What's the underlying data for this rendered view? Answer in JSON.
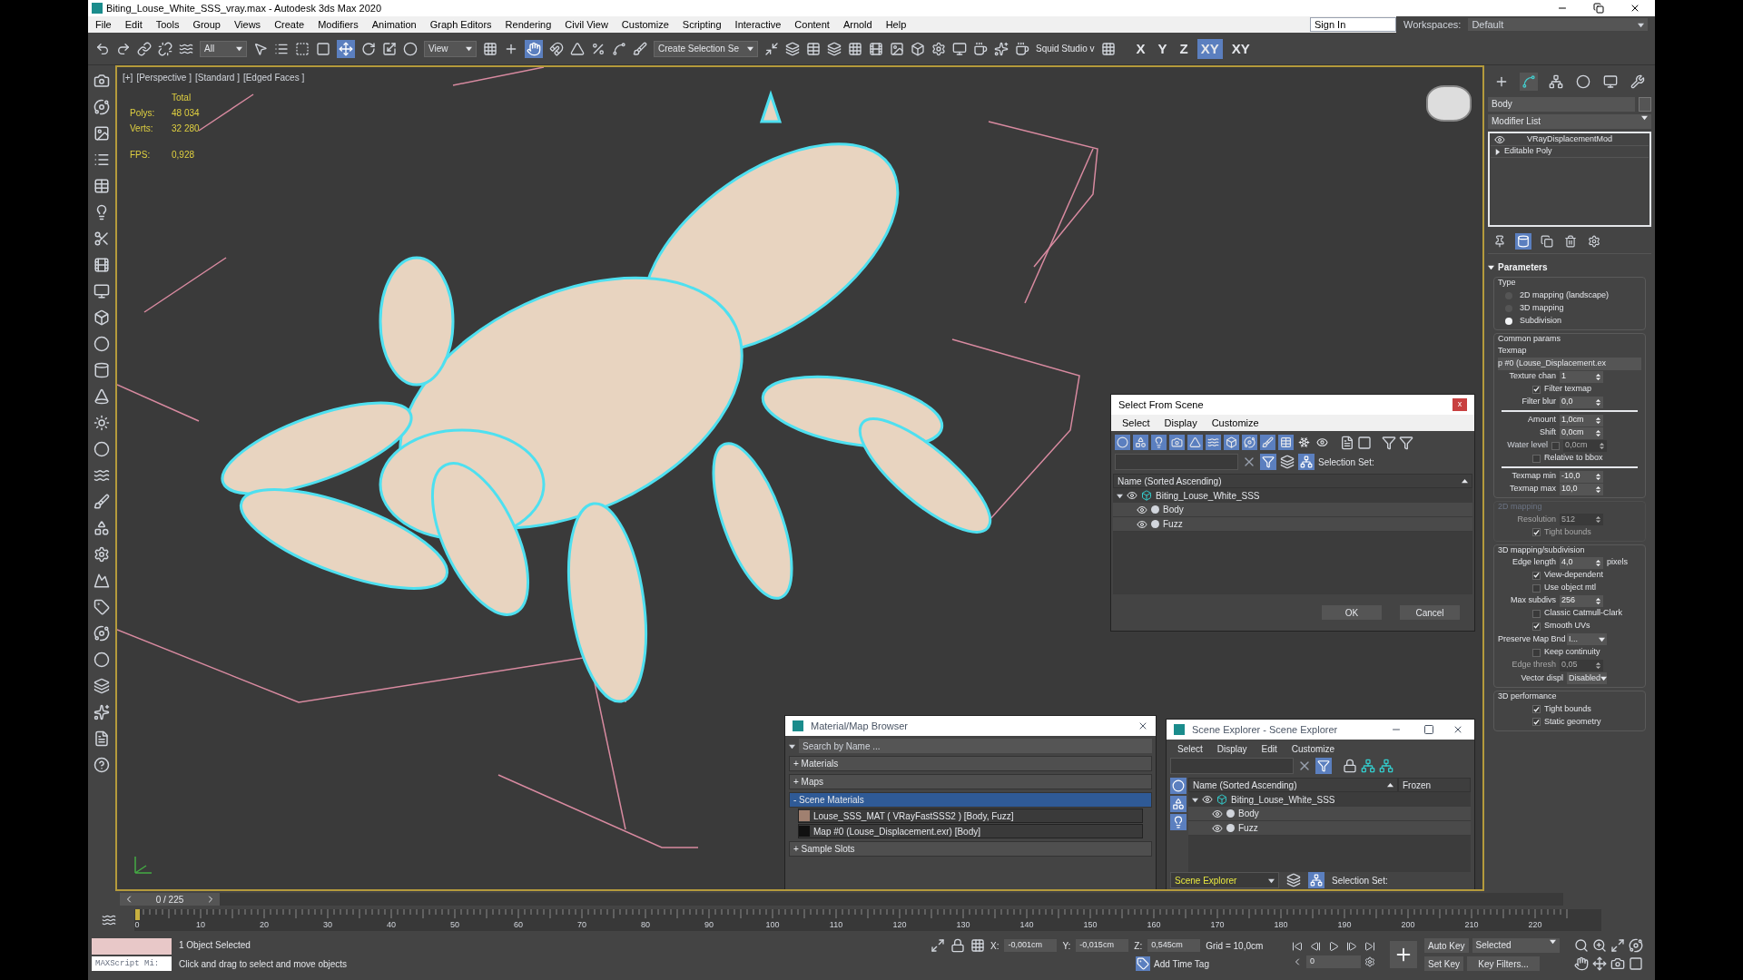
{
  "window": {
    "title": "Biting_Louse_White_SSS_vray.max - Autodesk 3ds Max 2020"
  },
  "menu": [
    "File",
    "Edit",
    "Tools",
    "Group",
    "Views",
    "Create",
    "Modifiers",
    "Animation",
    "Graph Editors",
    "Rendering",
    "Civil View",
    "Customize",
    "Scripting",
    "Interactive",
    "Content",
    "Arnold",
    "Help"
  ],
  "account": {
    "sign_in": "Sign In",
    "workspaces_label": "Workspaces:",
    "workspace": "Default"
  },
  "toolbar": {
    "selection_filter": "All",
    "reference_coord": "View",
    "named_selection": "Create Selection Se",
    "workspace_tool": "Squid Studio v",
    "axes": [
      {
        "label": "X",
        "selected": false
      },
      {
        "label": "Y",
        "selected": false
      },
      {
        "label": "Z",
        "selected": false
      },
      {
        "label": "XY",
        "selected": true
      },
      {
        "label": "XY",
        "selected": false
      }
    ]
  },
  "viewport": {
    "labels": [
      "[+]",
      "[Perspective ]",
      "[Standard ]",
      "[Edged Faces ]"
    ],
    "stats_header": "Total",
    "stats": [
      {
        "label": "Polys:",
        "value": "48 034"
      },
      {
        "label": "Verts:",
        "value": "32 280"
      }
    ],
    "fps": {
      "label": "FPS:",
      "value": "0,928"
    }
  },
  "select_from_scene": {
    "title": "Select From Scene",
    "close": "x",
    "menu": [
      "Select",
      "Display",
      "Customize"
    ],
    "filter_toggles": [
      {
        "selected": true
      },
      {
        "selected": true
      },
      {
        "selected": true
      },
      {
        "selected": true
      },
      {
        "selected": true
      },
      {
        "selected": true
      },
      {
        "selected": true
      },
      {
        "selected": true
      },
      {
        "selected": true
      },
      {
        "selected": true
      },
      {
        "selected": false
      },
      {
        "selected": false
      }
    ],
    "selection_set_label": "Selection Set:",
    "column": "Name (Sorted Ascending)",
    "tree": [
      {
        "name": "Biting_Louse_White_SSS",
        "expanded": true,
        "children": [
          {
            "name": "Body"
          },
          {
            "name": "Fuzz"
          }
        ]
      }
    ],
    "buttons": [
      "OK",
      "Cancel"
    ]
  },
  "material_browser": {
    "title": "Material/Map Browser",
    "search": {
      "placeholder": "Search by Name ..."
    },
    "groups": [
      {
        "label": "+ Materials",
        "selected": false
      },
      {
        "label": "+ Maps",
        "selected": false
      },
      {
        "label": "- Scene Materials",
        "selected": true,
        "items": [
          {
            "label": "Louse_SSS_MAT ( VRayFastSSS2 ) [Body, Fuzz]"
          },
          {
            "label": "Map #0 (Louse_Displacement.exr) [Body]"
          }
        ]
      },
      {
        "label": "+ Sample Slots",
        "selected": false
      }
    ]
  },
  "scene_explorer": {
    "title": "Scene Explorer - Scene Explorer",
    "menu": [
      "Select",
      "Display",
      "Edit",
      "Customize"
    ],
    "columns": [
      "Name (Sorted Ascending)",
      "Frozen"
    ],
    "tree": [
      {
        "name": "Biting_Louse_White_SSS",
        "expanded": true,
        "children": [
          {
            "name": "Body"
          },
          {
            "name": "Fuzz"
          }
        ]
      }
    ],
    "explorer_dropdown": "Scene Explorer",
    "selection_set_label": "Selection Set:"
  },
  "command_panel": {
    "tabs": [
      {
        "selected": false
      },
      {
        "selected": true
      },
      {
        "selected": false
      },
      {
        "selected": false
      },
      {
        "selected": false
      },
      {
        "selected": false
      }
    ],
    "object_name": "Body",
    "modifier_list": "Modifier List",
    "stack": [
      {
        "label": "VRayDisplacementMod",
        "kind": "modifier"
      },
      {
        "label": "Editable Poly",
        "kind": "base"
      }
    ],
    "stack_tools": [
      {
        "selected": false
      },
      {
        "selected": true
      },
      {
        "selected": false
      },
      {
        "selected": false
      },
      {
        "selected": false
      }
    ],
    "rollout": {
      "title": "Parameters",
      "expanded": true,
      "groups": [
        {
          "title": "Type",
          "disabled": false,
          "rows": [
            {
              "kind": "radio",
              "label": "2D mapping (landscape)",
              "selected": false,
              "disabled": false
            },
            {
              "kind": "radio",
              "label": "3D mapping",
              "selected": false,
              "disabled": false
            },
            {
              "kind": "radio",
              "label": "Subdivision",
              "selected": true,
              "disabled": false
            }
          ]
        },
        {
          "title": "Common params",
          "disabled": false,
          "rows": [
            {
              "kind": "label",
              "label": "Texmap",
              "disabled": false
            },
            {
              "kind": "map_button",
              "value": "p #0 (Louse_Displacement.ex",
              "disabled": false
            },
            {
              "kind": "spinner",
              "label": "Texture chan",
              "value": "1",
              "disabled": false
            },
            {
              "kind": "checkbox",
              "label": "Filter texmap",
              "checked": true,
              "disabled": false
            },
            {
              "kind": "spinner",
              "label": "Filter blur",
              "value": "0,0",
              "disabled": false
            },
            {
              "kind": "separator",
              "disabled": false
            },
            {
              "kind": "spinner",
              "label": "Amount",
              "value": "1,0cm",
              "disabled": false
            },
            {
              "kind": "spinner",
              "label": "Shift",
              "value": "0,0cm",
              "disabled": false
            },
            {
              "kind": "spinner_check",
              "label": "Water level",
              "checked": false,
              "value": "0,0cm",
              "disabled": true
            },
            {
              "kind": "checkbox",
              "label": "Relative to bbox",
              "checked": false,
              "disabled": false
            },
            {
              "kind": "separator",
              "disabled": false
            },
            {
              "kind": "spinner",
              "label": "Texmap min",
              "value": "-10,0",
              "disabled": false
            },
            {
              "kind": "spinner",
              "label": "Texmap max",
              "value": "10,0",
              "disabled": false
            }
          ]
        },
        {
          "title": "2D mapping",
          "disabled": true,
          "rows": [
            {
              "kind": "spinner",
              "label": "Resolution",
              "value": "512",
              "disabled": true
            },
            {
              "kind": "checkbox",
              "label": "Tight bounds",
              "checked": true,
              "disabled": true
            }
          ]
        },
        {
          "title": "3D mapping/subdivision",
          "disabled": false,
          "rows": [
            {
              "kind": "spinner",
              "label": "Edge length",
              "value": "4,0",
              "suffix": "pixels",
              "disabled": false
            },
            {
              "kind": "checkbox",
              "label": "View-dependent",
              "checked": true,
              "disabled": false
            },
            {
              "kind": "checkbox",
              "label": "Use object mtl",
              "checked": false,
              "disabled": false
            },
            {
              "kind": "spinner",
              "label": "Max subdivs",
              "value": "256",
              "disabled": false
            },
            {
              "kind": "checkbox",
              "label": "Classic Catmull-Clark",
              "checked": false,
              "disabled": false
            },
            {
              "kind": "checkbox",
              "label": "Smooth UVs",
              "checked": true,
              "disabled": false
            },
            {
              "kind": "dropdown",
              "label": "Preserve Map Bnd",
              "value": "I...",
              "disabled": false
            },
            {
              "kind": "checkbox",
              "label": "Keep continuity",
              "checked": false,
              "disabled": false
            },
            {
              "kind": "spinner",
              "label": "Edge thresh",
              "value": "0,05",
              "disabled": true
            },
            {
              "kind": "dropdown",
              "label": "Vector displ",
              "value": "Disabled",
              "disabled": false
            }
          ]
        },
        {
          "title": "3D performance",
          "disabled": false,
          "rows": [
            {
              "kind": "checkbox",
              "label": "Tight bounds",
              "checked": true,
              "disabled": false
            },
            {
              "kind": "checkbox",
              "label": "Static geometry",
              "checked": true,
              "disabled": false
            }
          ]
        }
      ]
    }
  },
  "time_slider": {
    "position": "0 / 225",
    "level": 0
  },
  "track_bar": {
    "ticks": [
      "0",
      "10",
      "20",
      "30",
      "40",
      "50",
      "60",
      "70",
      "80",
      "90",
      "100",
      "110",
      "120",
      "130",
      "140",
      "150",
      "160",
      "170",
      "180",
      "190",
      "200",
      "210",
      "220"
    ]
  },
  "status_bar": {
    "listener_placeholder": "MAXScript Mi:",
    "selection": "1 Object Selected",
    "prompt": "Click and drag to select and move objects",
    "coords": [
      {
        "label": "X:",
        "value": "-0,001cm"
      },
      {
        "label": "Y:",
        "value": "-0,015cm"
      },
      {
        "label": "Z:",
        "value": "0,545cm"
      }
    ],
    "grid": "Grid = 10,0cm",
    "add_time_tag": "Add Time Tag",
    "auto_key": "Auto Key",
    "set_key": "Set Key",
    "key_mode": "Selected",
    "key_filters": "Key Filters...",
    "frame": "0"
  }
}
